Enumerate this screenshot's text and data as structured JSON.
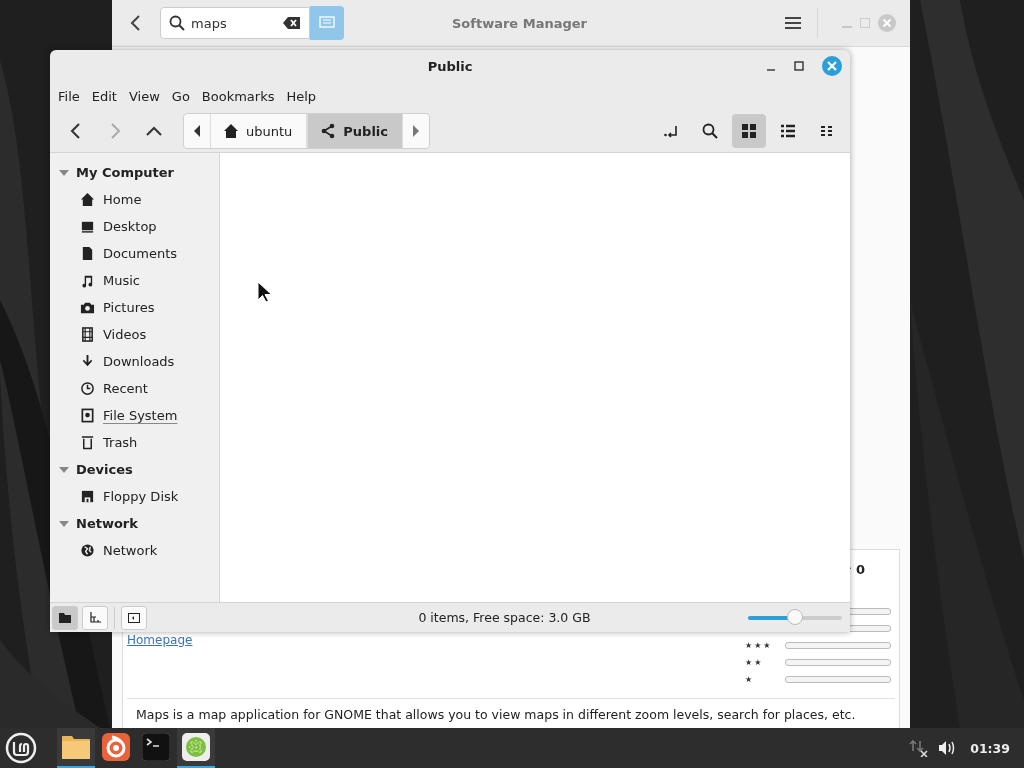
{
  "software_manager": {
    "title": "Software Manager",
    "search": {
      "value": "maps"
    },
    "homepage_link": "Homepage",
    "rating": {
      "count": "0",
      "rows": [
        {
          "level": 0
        },
        {
          "level": 0
        },
        {
          "label": "★★★",
          "level": 0
        },
        {
          "label": "★★",
          "level": 0
        },
        {
          "label": "★",
          "level": 0
        }
      ]
    },
    "description": "Maps is a map application for GNOME that allows you to view maps in different zoom levels, search for places, etc."
  },
  "file_manager": {
    "title": "Public",
    "menu": [
      "File",
      "Edit",
      "View",
      "Go",
      "Bookmarks",
      "Help"
    ],
    "path": [
      {
        "label": "ubuntu",
        "kind": "home",
        "selected": false
      },
      {
        "label": "Public",
        "kind": "share",
        "selected": true
      }
    ],
    "view_modes": [
      {
        "kind": "icons",
        "selected": true
      },
      {
        "kind": "list",
        "selected": false
      },
      {
        "kind": "compact",
        "selected": false
      }
    ],
    "sidebar": [
      {
        "label": "My Computer",
        "expanded": true,
        "children": [
          {
            "label": "Home",
            "kind": "home",
            "hovered": false
          },
          {
            "label": "Desktop",
            "kind": "desktop",
            "hovered": false
          },
          {
            "label": "Documents",
            "kind": "document",
            "hovered": false
          },
          {
            "label": "Music",
            "kind": "music",
            "hovered": false
          },
          {
            "label": "Pictures",
            "kind": "camera",
            "hovered": false
          },
          {
            "label": "Videos",
            "kind": "film",
            "hovered": false
          },
          {
            "label": "Downloads",
            "kind": "download",
            "hovered": false
          },
          {
            "label": "Recent",
            "kind": "clock",
            "hovered": false
          },
          {
            "label": "File System",
            "kind": "drive",
            "hovered": true
          },
          {
            "label": "Trash",
            "kind": "trash",
            "hovered": false
          }
        ]
      },
      {
        "label": "Devices",
        "expanded": true,
        "children": [
          {
            "label": "Floppy Disk",
            "kind": "floppy",
            "hovered": false
          }
        ]
      },
      {
        "label": "Network",
        "expanded": true,
        "children": [
          {
            "label": "Network",
            "kind": "globe",
            "hovered": false
          }
        ]
      }
    ],
    "pane_buttons": [
      {
        "kind": "places",
        "selected": true
      },
      {
        "kind": "tree",
        "selected": false
      }
    ],
    "status": "0 items, Free space: 3.0 GB",
    "zoom": {
      "level": 0.5
    }
  },
  "taskbar": {
    "apps": [
      {
        "kind": "files",
        "active": true
      },
      {
        "kind": "browser",
        "active": false
      },
      {
        "kind": "terminal",
        "active": false
      },
      {
        "kind": "grid",
        "active": true
      }
    ],
    "clock": "01:39"
  }
}
